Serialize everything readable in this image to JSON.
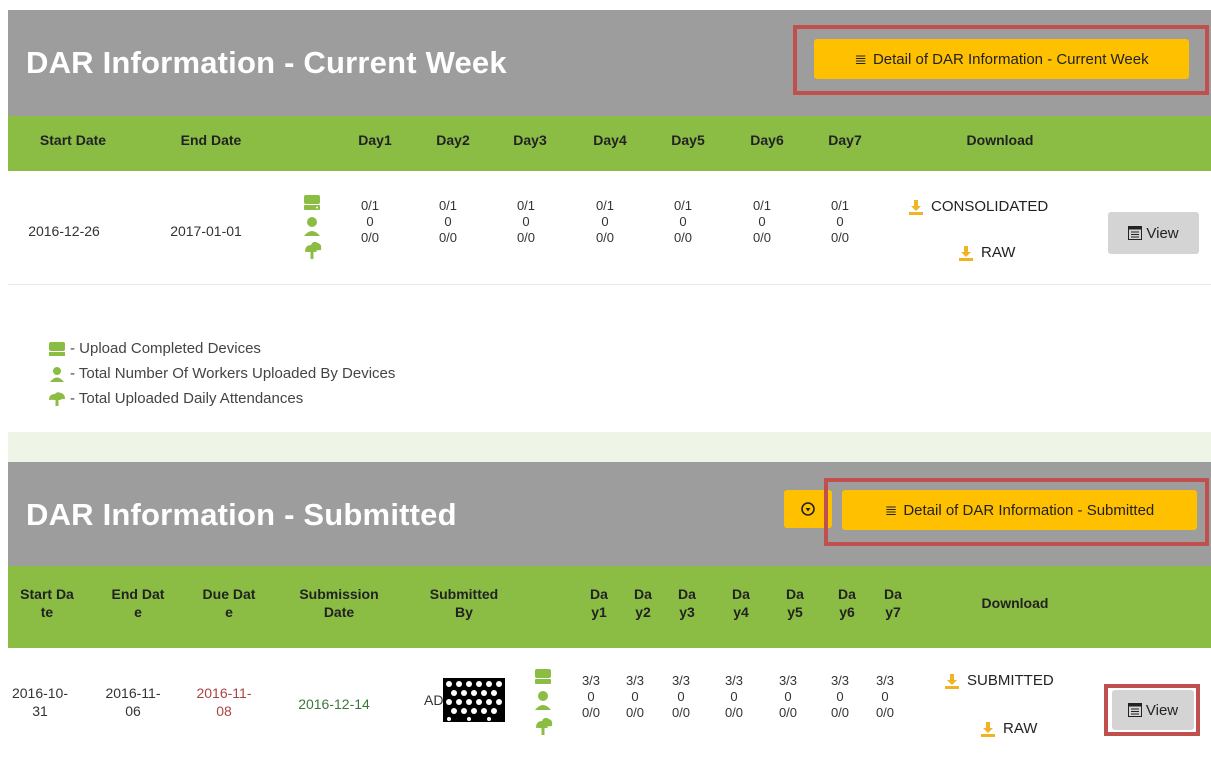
{
  "current_week": {
    "title": "DAR Information - Current Week",
    "detail_button": "Detail of DAR Information - Current Week",
    "headers": [
      "Start Date",
      "End Date",
      "Day1",
      "Day2",
      "Day3",
      "Day4",
      "Day5",
      "Day6",
      "Day7",
      "Download"
    ],
    "row": {
      "start_date": "2016-12-26",
      "end_date": "2017-01-01",
      "days": [
        {
          "devices": "0/1",
          "workers": "0",
          "attendance": "0/0"
        },
        {
          "devices": "0/1",
          "workers": "0",
          "attendance": "0/0"
        },
        {
          "devices": "0/1",
          "workers": "0",
          "attendance": "0/0"
        },
        {
          "devices": "0/1",
          "workers": "0",
          "attendance": "0/0"
        },
        {
          "devices": "0/1",
          "workers": "0",
          "attendance": "0/0"
        },
        {
          "devices": "0/1",
          "workers": "0",
          "attendance": "0/0"
        },
        {
          "devices": "0/1",
          "workers": "0",
          "attendance": "0/0"
        }
      ],
      "download_consolidated": "CONSOLIDATED",
      "download_raw": "RAW",
      "view_label": "View"
    }
  },
  "legend": {
    "devices": "- Upload Completed Devices",
    "workers": "- Total Number Of Workers Uploaded By Devices",
    "attendance": "- Total Uploaded Daily Attendances"
  },
  "submitted": {
    "title": "DAR Information - Submitted",
    "detail_button": "Detail of DAR Information - Submitted",
    "headers": {
      "start": [
        "Start Da",
        "te"
      ],
      "end": [
        "End Dat",
        "e"
      ],
      "due": [
        "Due Dat",
        "e"
      ],
      "submission": [
        "Submission",
        "Date"
      ],
      "submitted_by": [
        "Submitted",
        "By"
      ],
      "days": [
        [
          "Da",
          "y1"
        ],
        [
          "Da",
          "y2"
        ],
        [
          "Da",
          "y3"
        ],
        [
          "Da",
          "y4"
        ],
        [
          "Da",
          "y5"
        ],
        [
          "Da",
          "y6"
        ],
        [
          "Da",
          "y7"
        ]
      ],
      "download": "Download"
    },
    "row": {
      "start_date": [
        "2016-10-",
        "31"
      ],
      "end_date": [
        "2016-11-",
        "06"
      ],
      "due_date": [
        "2016-11-",
        "08"
      ],
      "submission_date": "2016-12-14",
      "submitted_by_prefix": "AD",
      "days": [
        {
          "devices": "3/3",
          "workers": "0",
          "attendance": "0/0"
        },
        {
          "devices": "3/3",
          "workers": "0",
          "attendance": "0/0"
        },
        {
          "devices": "3/3",
          "workers": "0",
          "attendance": "0/0"
        },
        {
          "devices": "3/3",
          "workers": "0",
          "attendance": "0/0"
        },
        {
          "devices": "3/3",
          "workers": "0",
          "attendance": "0/0"
        },
        {
          "devices": "3/3",
          "workers": "0",
          "attendance": "0/0"
        },
        {
          "devices": "3/3",
          "workers": "0",
          "attendance": "0/0"
        }
      ],
      "download_submitted": "SUBMITTED",
      "download_raw": "RAW",
      "view_label": "View"
    }
  },
  "colors": {
    "header_gray": "#9d9d9d",
    "table_green": "#8bbd45",
    "button_yellow": "#ffc000",
    "highlight_red": "#c0504d",
    "due_date_red": "#a94442",
    "submission_green": "#3c763d"
  },
  "icons": [
    "list-icon",
    "download-circle-icon",
    "download-icon",
    "drive-icon",
    "user-icon",
    "cloud-upload-icon",
    "table-icon"
  ]
}
